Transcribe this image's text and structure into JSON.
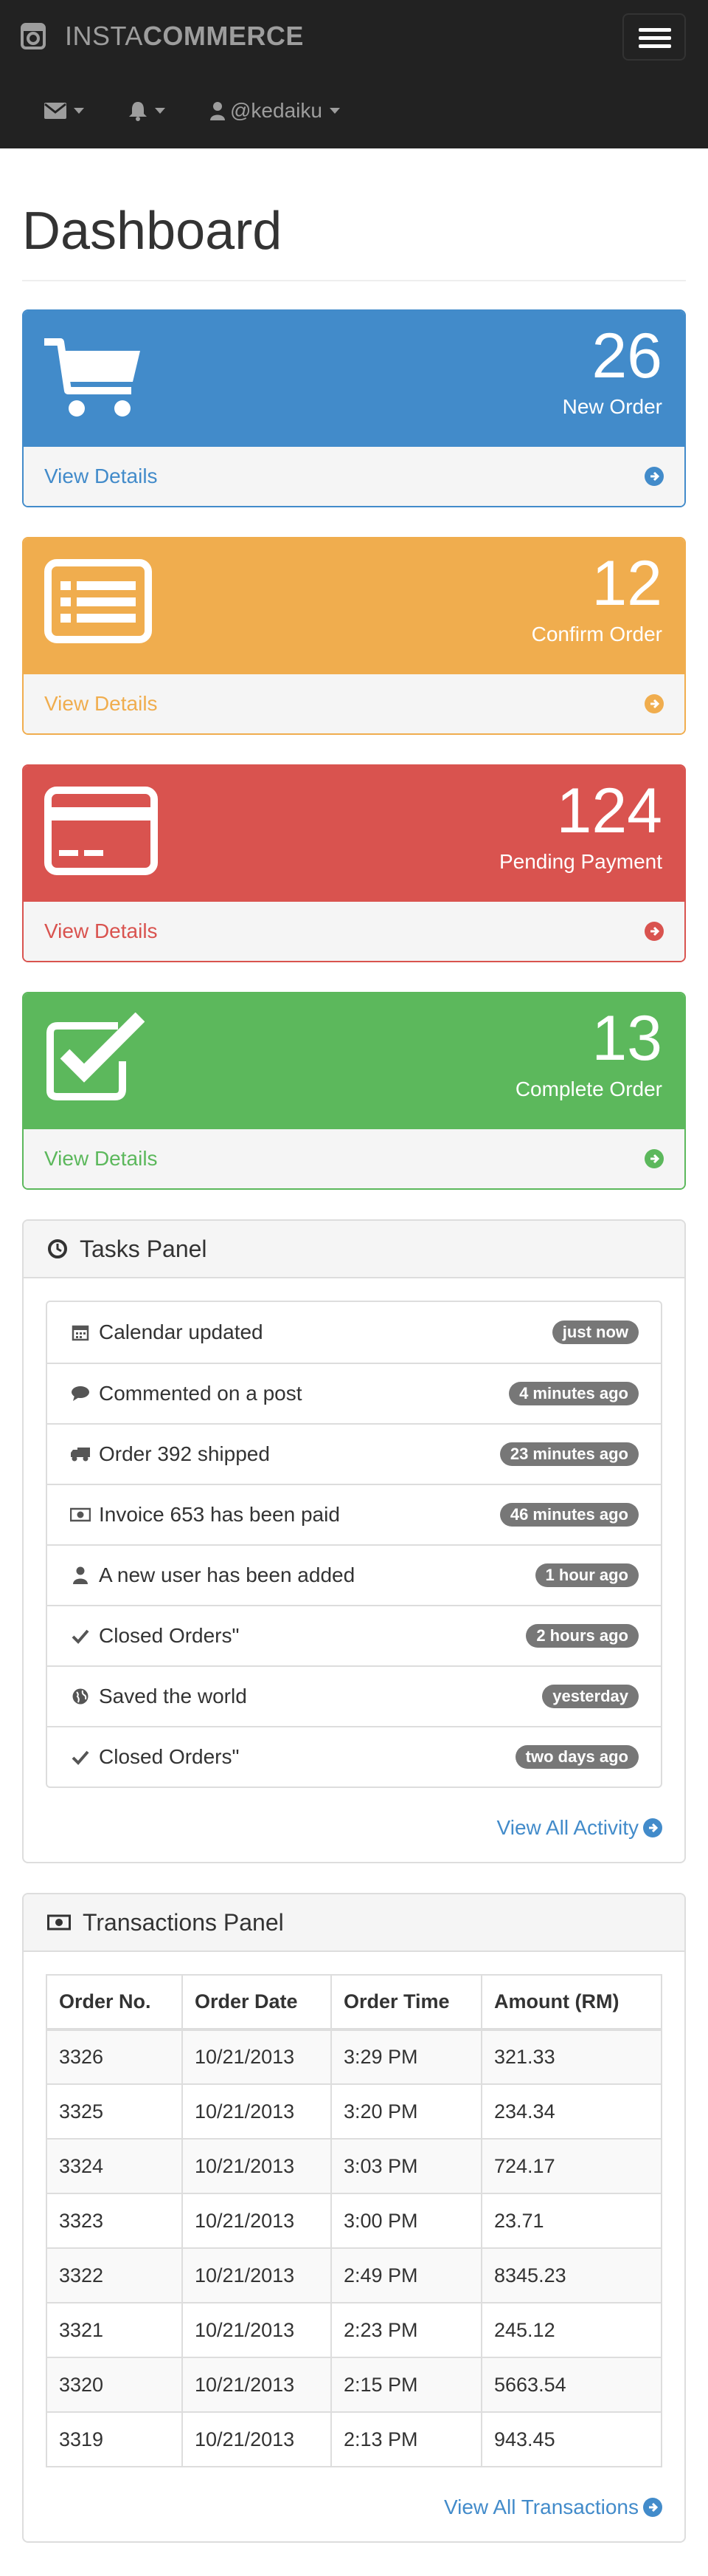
{
  "navbar": {
    "brand_light": "INSTA",
    "brand_bold": "COMMERCE",
    "brand_icon": "instagram-icon",
    "toggle_icon": "hamburger-icon",
    "items": [
      {
        "icon": "envelope-icon",
        "label": ""
      },
      {
        "icon": "bell-icon",
        "label": ""
      },
      {
        "icon": "user-icon",
        "label": "@kedaiku"
      }
    ]
  },
  "page": {
    "title": "Dashboard"
  },
  "stats": [
    {
      "value": "26",
      "label": "New Order",
      "link": "View Details",
      "icon": "shopping-cart-icon",
      "color": "#428bca"
    },
    {
      "value": "12",
      "label": "Confirm Order",
      "link": "View Details",
      "icon": "list-alt-icon",
      "color": "#f0ad4e"
    },
    {
      "value": "124",
      "label": "Pending Payment",
      "link": "View Details",
      "icon": "credit-card-icon",
      "color": "#d9534f"
    },
    {
      "value": "13",
      "label": "Complete Order",
      "link": "View Details",
      "icon": "check-square-icon",
      "color": "#5cb85c"
    }
  ],
  "tasks": {
    "title": "Tasks Panel",
    "title_icon": "clock-icon",
    "items": [
      {
        "icon": "calendar-icon",
        "text": "Calendar updated",
        "time": "just now"
      },
      {
        "icon": "comment-icon",
        "text": "Commented on a post",
        "time": "4 minutes ago"
      },
      {
        "icon": "truck-icon",
        "text": "Order 392 shipped",
        "time": "23 minutes ago"
      },
      {
        "icon": "money-icon",
        "text": "Invoice 653 has been paid",
        "time": "46 minutes ago"
      },
      {
        "icon": "user-icon",
        "text": "A new user has been added",
        "time": "1 hour ago"
      },
      {
        "icon": "check-icon",
        "text": "Closed Orders\"",
        "time": "2 hours ago"
      },
      {
        "icon": "globe-icon",
        "text": "Saved the world",
        "time": "yesterday"
      },
      {
        "icon": "check-icon",
        "text": "Closed Orders\"",
        "time": "two days ago"
      }
    ],
    "more": "View All Activity"
  },
  "transactions": {
    "title": "Transactions Panel",
    "title_icon": "money-icon",
    "columns": [
      "Order No.",
      "Order Date",
      "Order Time",
      "Amount (RM)"
    ],
    "rows": [
      [
        "3326",
        "10/21/2013",
        "3:29 PM",
        "321.33"
      ],
      [
        "3325",
        "10/21/2013",
        "3:20 PM",
        "234.34"
      ],
      [
        "3324",
        "10/21/2013",
        "3:03 PM",
        "724.17"
      ],
      [
        "3323",
        "10/21/2013",
        "3:00 PM",
        "23.71"
      ],
      [
        "3322",
        "10/21/2013",
        "2:49 PM",
        "8345.23"
      ],
      [
        "3321",
        "10/21/2013",
        "2:23 PM",
        "245.12"
      ],
      [
        "3320",
        "10/21/2013",
        "2:15 PM",
        "5663.54"
      ],
      [
        "3319",
        "10/21/2013",
        "2:13 PM",
        "943.45"
      ]
    ],
    "more": "View All Transactions"
  }
}
